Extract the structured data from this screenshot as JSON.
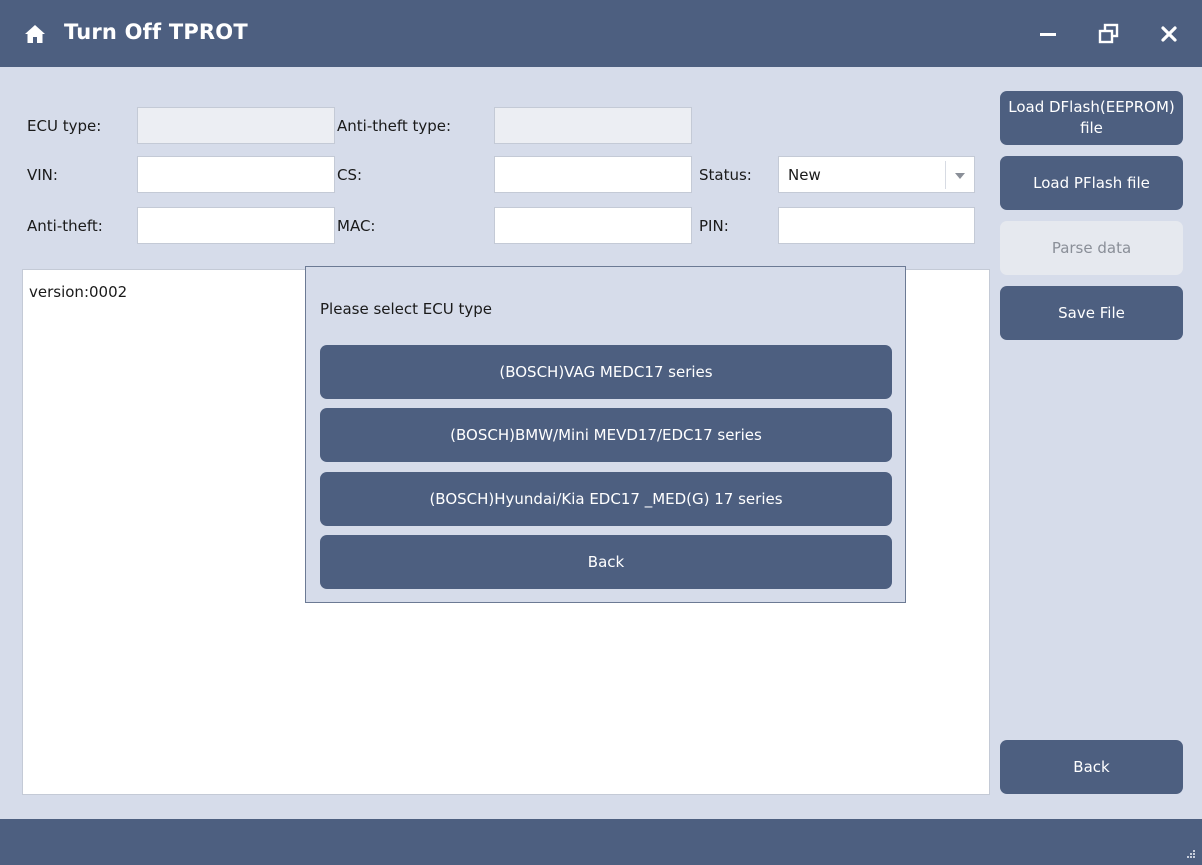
{
  "window": {
    "title": "Turn Off TPROT",
    "icons": {
      "home": "home-icon",
      "minimize": "minimize-icon",
      "restore": "restore-icon",
      "close": "close-icon"
    },
    "colors": {
      "primary": "#4d5f80",
      "background": "#d6dcea",
      "disabled": "#e6e9ef"
    }
  },
  "form": {
    "ecu_type": {
      "label": "ECU type:",
      "value": ""
    },
    "anti_theft_type": {
      "label": "Anti-theft type:",
      "value": ""
    },
    "vin": {
      "label": "VIN:",
      "value": ""
    },
    "cs": {
      "label": "CS:",
      "value": ""
    },
    "status": {
      "label": "Status:",
      "value": "New"
    },
    "anti_theft": {
      "label": "Anti-theft:",
      "value": ""
    },
    "mac": {
      "label": "MAC:",
      "value": ""
    },
    "pin": {
      "label": "PIN:",
      "value": ""
    }
  },
  "log": {
    "text": "version:0002"
  },
  "sidebar": {
    "load_dflash": "Load DFlash(EEPROM) file",
    "load_pflash": "Load PFlash file",
    "parse_data": "Parse data",
    "save_file": "Save File",
    "back": "Back"
  },
  "popup": {
    "title": "Please select ECU type",
    "options": [
      "(BOSCH)VAG MEDC17 series",
      "(BOSCH)BMW/Mini MEVD17/EDC17 series",
      "(BOSCH)Hyundai/Kia EDC17 _MED(G) 17 series"
    ],
    "back": "Back"
  }
}
